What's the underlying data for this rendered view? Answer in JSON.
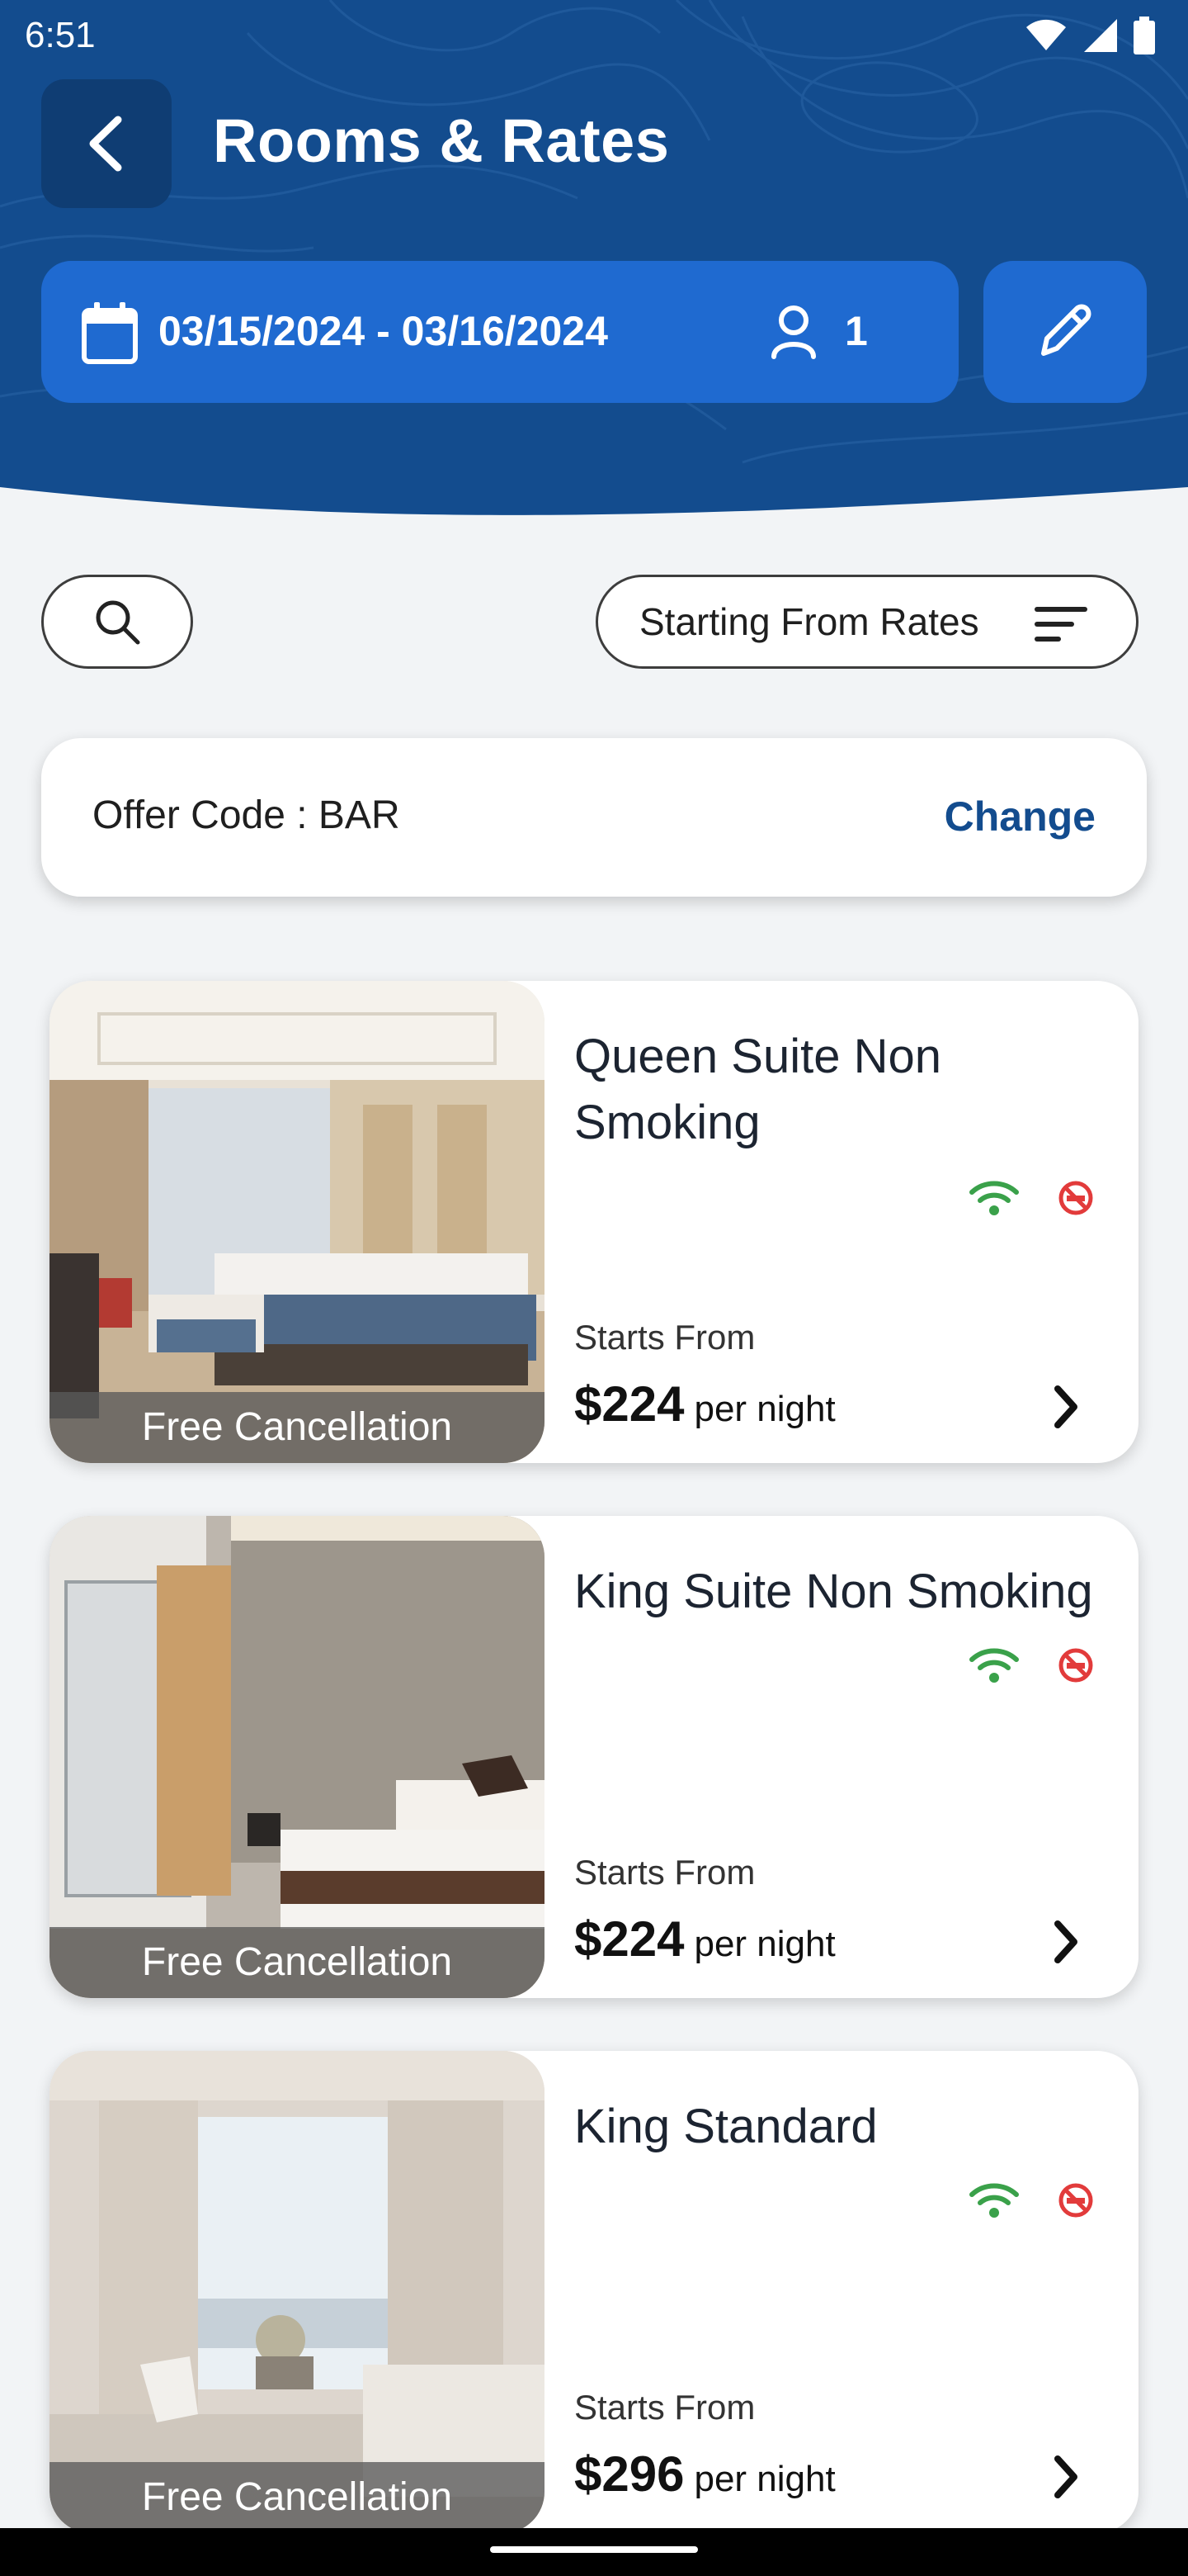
{
  "status": {
    "time": "6:51"
  },
  "header": {
    "title": "Rooms & Rates",
    "dates": "03/15/2024 - 03/16/2024",
    "guests": "1"
  },
  "controls": {
    "sort_label": "Starting From Rates"
  },
  "offer": {
    "label": "Offer Code : BAR",
    "change_label": "Change"
  },
  "rooms": [
    {
      "name": "Queen Suite Non Smoking",
      "badge": "Free Cancellation",
      "starts_from": "Starts From",
      "price": "$224",
      "per": "per night"
    },
    {
      "name": "King Suite Non Smoking",
      "badge": "Free Cancellation",
      "starts_from": "Starts From",
      "price": "$224",
      "per": "per night"
    },
    {
      "name": "King Standard",
      "badge": "Free Cancellation",
      "starts_from": "Starts From",
      "price": "$296",
      "per": "per night"
    }
  ],
  "colors": {
    "header_blue": "#134c8e",
    "button_blue": "#1f6ad0",
    "wifi_green": "#3aa14a",
    "no_smoking_red": "#e23b3b"
  }
}
